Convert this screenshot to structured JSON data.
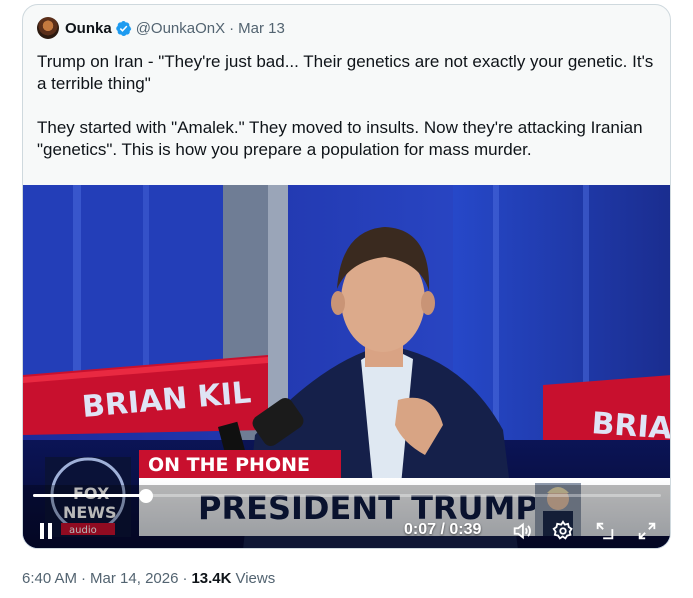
{
  "quote": {
    "name": "Ounka",
    "handle": "@OunkaOnX",
    "separator": "·",
    "date": "Mar 13",
    "text_1": "Trump on Iran - \"They're just bad... Their genetics are not exactly your genetic. It's a terrible thing\"",
    "text_2": "They started with \"Amalek.\" They moved to insults. Now they're attacking Iranian \"genetics\". This is how you prepare a population for mass murder."
  },
  "video": {
    "backdrop_name": "BRIAN KIL",
    "backdrop_name_right": "BRIA",
    "lower_third_top": "ON THE PHONE",
    "lower_third_main": "PRESIDENT TRUMP",
    "network_logo_1": "FOX",
    "network_logo_2": "NEWS",
    "network_logo_3": "audio",
    "time_display": "0:07 / 0:39",
    "progress_fraction": 0.18
  },
  "post_meta": {
    "time": "6:40 AM",
    "separator": "·",
    "date": "Mar 14, 2026",
    "views_count": "13.4K",
    "views_label": "Views"
  },
  "colors": {
    "verified": "#1d9bf0",
    "muted_text": "#536471",
    "fox_red": "#c8102e",
    "studio_blue": "#1c3bb8"
  },
  "icons": [
    "verified-badge-icon",
    "pause-icon",
    "volume-icon",
    "settings-icon",
    "picture-in-picture-icon",
    "fullscreen-icon"
  ]
}
